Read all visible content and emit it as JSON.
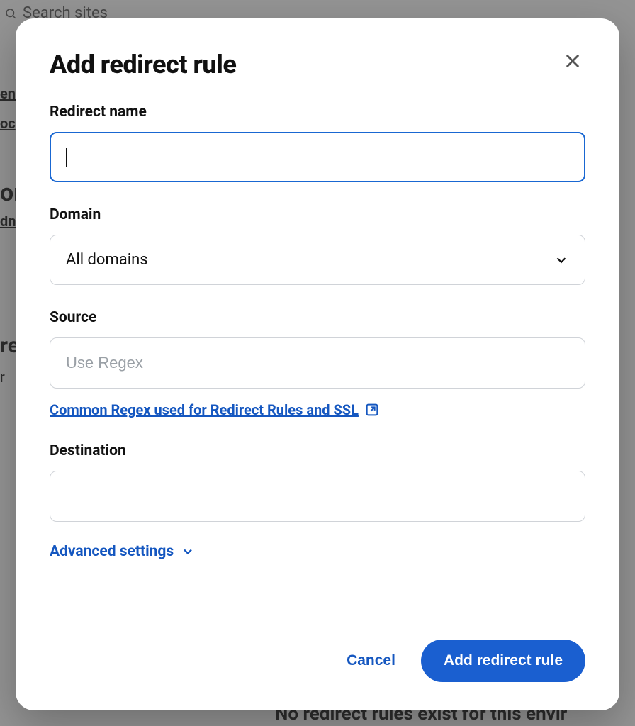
{
  "backdrop": {
    "search_placeholder": "Search sites",
    "frag_en": "en",
    "frag_oc": "oc",
    "frag_or": "or",
    "frag_dn": "dn",
    "frag_re": "re",
    "frag_r": " r",
    "frag_bottom": "No redirect rules exist for this envir"
  },
  "modal": {
    "title": "Add redirect rule",
    "redirect_name_label": "Redirect name",
    "redirect_name_value": "",
    "domain_label": "Domain",
    "domain_selected": "All domains",
    "source_label": "Source",
    "source_placeholder": "Use Regex",
    "source_value": "",
    "help_link": "Common Regex used for Redirect Rules and SSL",
    "destination_label": "Destination",
    "destination_value": "",
    "advanced_label": "Advanced settings",
    "cancel_label": "Cancel",
    "submit_label": "Add redirect rule"
  },
  "colors": {
    "primary": "#1a5fd0",
    "link": "#1557c0",
    "focus_border": "#1967d2"
  }
}
